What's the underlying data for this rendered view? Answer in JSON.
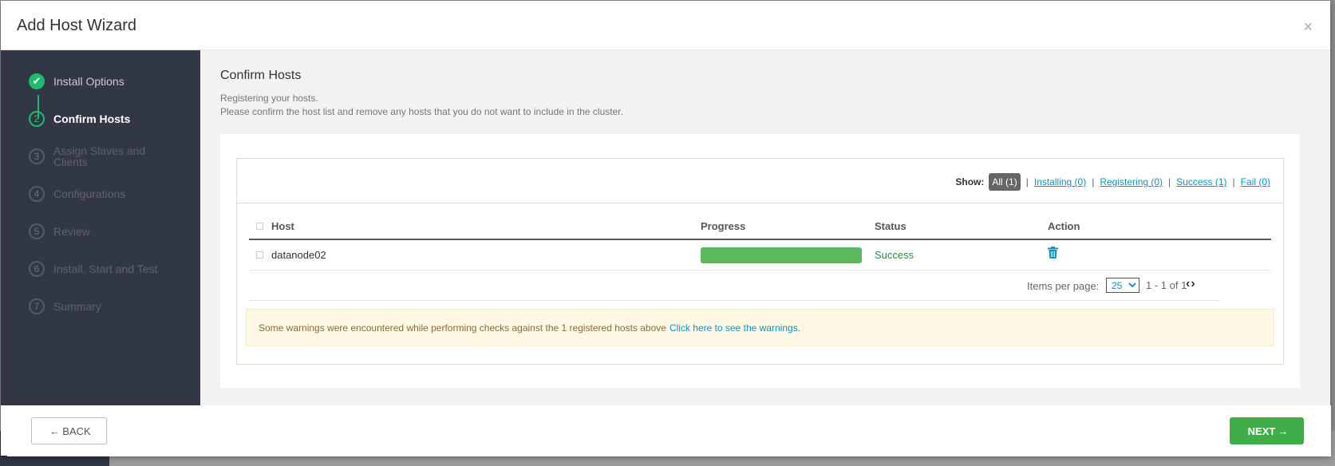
{
  "modal": {
    "title": "Add Host Wizard",
    "close_glyph": "×"
  },
  "sidebar": {
    "steps": [
      {
        "number": "✔",
        "label": "Install Options",
        "state": "done"
      },
      {
        "number": "2",
        "label": "Confirm Hosts",
        "state": "active"
      },
      {
        "number": "3",
        "label": "Assign Slaves and Clients",
        "state": "pending"
      },
      {
        "number": "4",
        "label": "Configurations",
        "state": "pending"
      },
      {
        "number": "5",
        "label": "Review",
        "state": "pending"
      },
      {
        "number": "6",
        "label": "Install, Start and Test",
        "state": "pending"
      },
      {
        "number": "7",
        "label": "Summary",
        "state": "pending"
      }
    ]
  },
  "main": {
    "title": "Confirm Hosts",
    "subtitle_line1": "Registering your hosts.",
    "subtitle_line2": "Please confirm the host list and remove any hosts that you do not want to include in the cluster."
  },
  "filters": {
    "show_label": "Show:",
    "all": "All (1)",
    "installing": "Installing (0)",
    "registering": "Registering (0)",
    "success": "Success (1)",
    "fail": "Fail (0)",
    "separator": "|"
  },
  "table": {
    "headers": {
      "host": "Host",
      "progress": "Progress",
      "status": "Status",
      "action": "Action"
    },
    "rows": [
      {
        "host": "datanode02",
        "progress_percent": 100,
        "status": "Success",
        "action_icon": "trash-icon"
      }
    ]
  },
  "pager": {
    "items_per_page_label": "Items per page:",
    "items_per_page_value": "25",
    "range": "1 - 1 of 1",
    "nav_glyph": "‹›"
  },
  "warning": {
    "text": "Some warnings were encountered while performing checks against the 1 registered hosts above",
    "link": "Click here to see the warnings."
  },
  "footer": {
    "back_arrow": "←",
    "back_label": "BACK",
    "next_label": "NEXT",
    "next_arrow": "→"
  },
  "colors": {
    "sidebar_bg": "#323746",
    "step_done": "#1ebb6d",
    "progress_fill": "#5cb85c",
    "next_button": "#3fae49",
    "link": "#1491c1"
  }
}
